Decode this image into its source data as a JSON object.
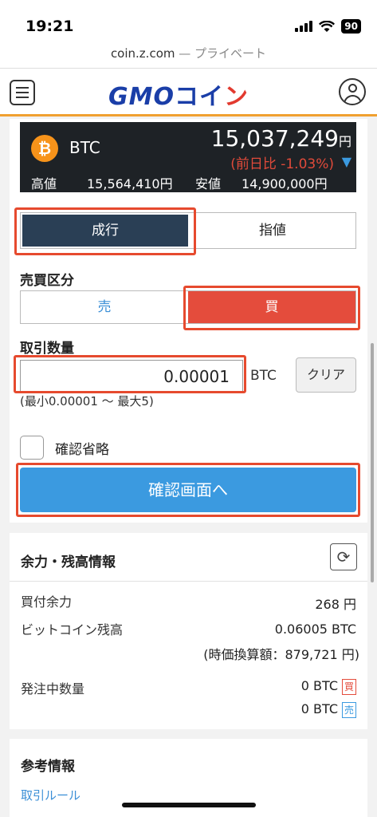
{
  "status_bar": {
    "time": "19:21",
    "battery": "90"
  },
  "browser": {
    "domain": "coin.z.com",
    "mode": "— プライベート"
  },
  "header": {
    "logo_gmo": "GMO",
    "logo_coin": "コイ",
    "logo_n": "ン"
  },
  "ticker": {
    "pair": "BTC",
    "price": "15,037,249",
    "price_unit": "円",
    "change": "(前日比 -1.03%)",
    "high_label": "高値",
    "high_value": "15,564,410円",
    "low_label": "安値",
    "low_value": "14,900,000円"
  },
  "order_type": {
    "market": "成行",
    "limit": "指値"
  },
  "side": {
    "label": "売買区分",
    "sell": "売",
    "buy": "買"
  },
  "quantity": {
    "label": "取引数量",
    "value": "0.00001",
    "unit": "BTC",
    "clear": "クリア",
    "range": "(最小0.00001 〜 最大5)"
  },
  "skip_confirm": {
    "label": "確認省略"
  },
  "confirm_button": "確認画面へ",
  "balance": {
    "title": "余力・残高情報",
    "buying_power_label": "買付余力",
    "buying_power_value": "268 円",
    "btc_balance_label": "ビットコイン残高",
    "btc_balance_value": "0.06005 BTC",
    "btc_valuation": "(時価換算額：879,721 円)",
    "pending_label": "発注中数量",
    "pending_buy_value": "0 BTC",
    "pending_buy_tag": "買",
    "pending_sell_value": "0 BTC",
    "pending_sell_tag": "売"
  },
  "reference": {
    "title": "参考情報",
    "trading_rules": "取引ルール"
  },
  "colors": {
    "accent_orange": "#f0a030",
    "buy_red": "#e44c3c",
    "sell_blue": "#3b9ae0",
    "highlight": "#e64a2e",
    "dark_navy": "#2a3f55"
  }
}
